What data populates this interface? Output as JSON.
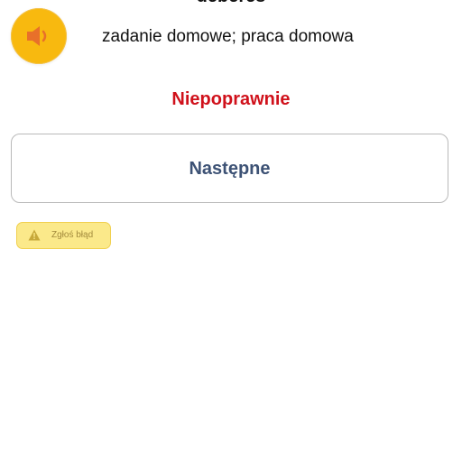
{
  "word": {
    "title": "deberes",
    "translation": "zadanie domowe; praca domowa"
  },
  "audio": {
    "icon": "speaker-icon",
    "color": "#f8b90f"
  },
  "feedback": {
    "result": "Niepoprawnie",
    "result_color": "#d0111b"
  },
  "actions": {
    "next_label": "Następne",
    "report_label": "Zgłoś błąd",
    "report_icon": "warning-icon"
  }
}
